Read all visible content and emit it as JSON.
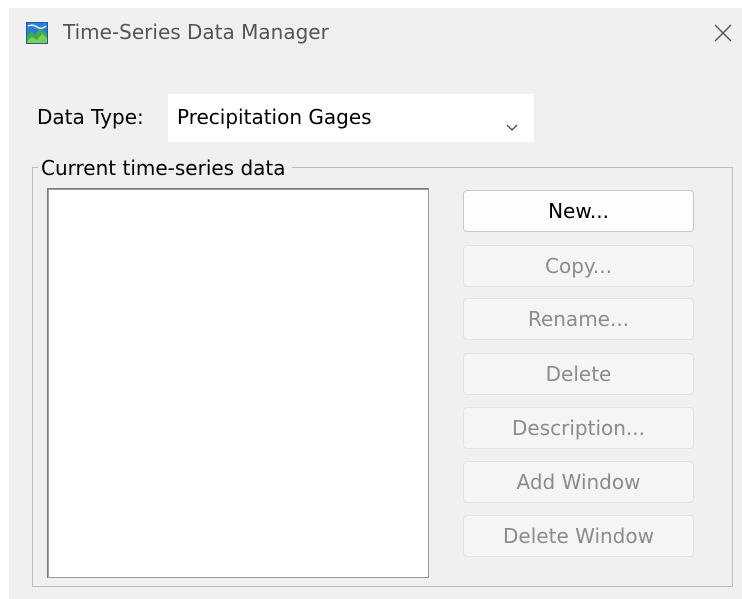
{
  "window": {
    "title": "Time-Series Data Manager",
    "icon": "map-terrain-icon",
    "close_icon": "close-icon"
  },
  "data_type": {
    "label": "Data Type:",
    "selected": "Precipitation Gages",
    "dropdown_icon": "chevron-down-icon"
  },
  "group": {
    "caption": "Current time-series data",
    "items": []
  },
  "buttons": {
    "new": {
      "label": "New...",
      "enabled": true
    },
    "copy": {
      "label": "Copy...",
      "enabled": false
    },
    "rename": {
      "label": "Rename...",
      "enabled": false
    },
    "delete": {
      "label": "Delete",
      "enabled": false
    },
    "description": {
      "label": "Description...",
      "enabled": false
    },
    "add_window": {
      "label": "Add Window",
      "enabled": false
    },
    "delete_window": {
      "label": "Delete Window",
      "enabled": false
    }
  },
  "colors": {
    "window_bg": "#f0f0f0",
    "disabled_text": "#8c8c8c",
    "icon_green": "#2e9e3e",
    "icon_blue": "#3a7bd5"
  }
}
